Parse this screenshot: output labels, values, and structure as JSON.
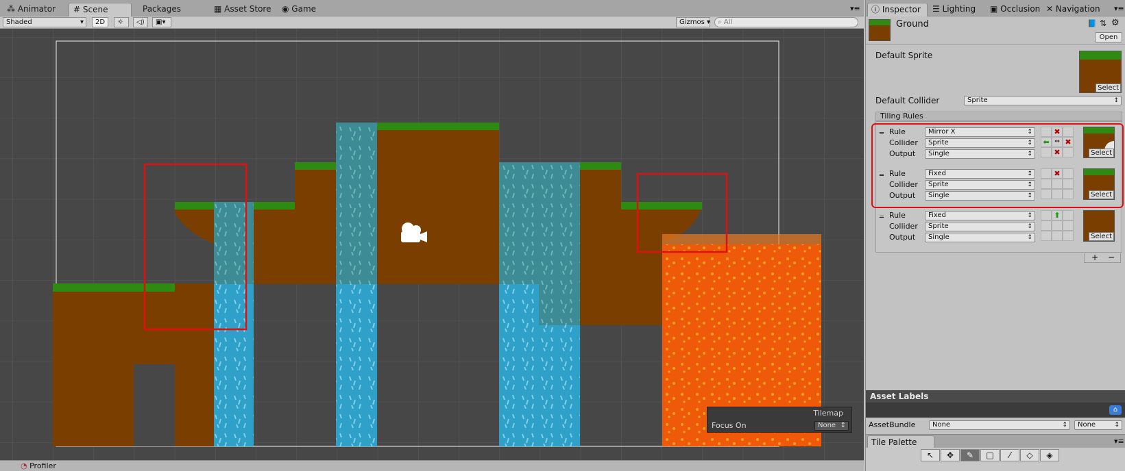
{
  "scene_tabs": [
    {
      "icon": "animator-icon",
      "label": "Animator"
    },
    {
      "icon": "scene-grid-icon",
      "label": "Scene"
    },
    {
      "icon": "",
      "label": "Packages"
    },
    {
      "icon": "asset-store-icon",
      "label": "Asset Store"
    },
    {
      "icon": "game-icon",
      "label": "Game"
    }
  ],
  "toolbar": {
    "shading": "Shaded",
    "mode2d": "2D",
    "gizmos": "Gizmos",
    "search_placeholder": "All"
  },
  "tilemap_overlay": {
    "title": "Tilemap",
    "focus_label": "Focus On",
    "focus_value": "None"
  },
  "bottom_tab": "Profiler",
  "inspector_tabs": [
    {
      "icon": "info-icon",
      "label": "Inspector"
    },
    {
      "icon": "lighting-icon",
      "label": "Lighting"
    },
    {
      "icon": "occlusion-icon",
      "label": "Occlusion"
    },
    {
      "icon": "navigation-icon",
      "label": "Navigation"
    }
  ],
  "asset": {
    "name": "Ground",
    "open_label": "Open"
  },
  "default_sprite_label": "Default Sprite",
  "select_label": "Select",
  "default_collider": {
    "label": "Default Collider",
    "value": "Sprite"
  },
  "tiling_rules_label": "Tiling Rules",
  "rules": [
    {
      "rule_label": "Rule",
      "rule_value": "Mirror X",
      "collider_label": "Collider",
      "collider_value": "Sprite",
      "output_label": "Output",
      "output_value": "Single"
    },
    {
      "rule_label": "Rule",
      "rule_value": "Fixed",
      "collider_label": "Collider",
      "collider_value": "Sprite",
      "output_label": "Output",
      "output_value": "Single"
    },
    {
      "rule_label": "Rule",
      "rule_value": "Fixed",
      "collider_label": "Collider",
      "collider_value": "Sprite",
      "output_label": "Output",
      "output_value": "Single"
    }
  ],
  "list_buttons": {
    "add": "+",
    "remove": "−"
  },
  "asset_labels": "Asset Labels",
  "asset_bundle": {
    "label": "AssetBundle",
    "value": "None",
    "variant": "None"
  },
  "tile_palette": "Tile Palette",
  "colors": {
    "ground": "#7a3f00",
    "grass": "#2f8a12",
    "water": "#2fa0c8",
    "lava": "#f06010",
    "scene_bg": "#474747"
  }
}
